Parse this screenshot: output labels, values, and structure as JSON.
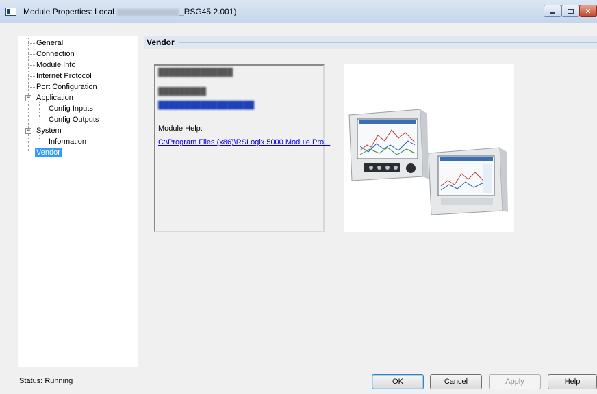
{
  "window": {
    "title_prefix": "Module Properties: Local ",
    "title_suffix": "_RSG45 2.001)",
    "controls": [
      "minimize-icon",
      "maximize-icon",
      "close-icon"
    ],
    "close_glyph": "✕"
  },
  "tree": {
    "items": [
      {
        "label": "General"
      },
      {
        "label": "Connection"
      },
      {
        "label": "Module Info"
      },
      {
        "label": "Internet Protocol"
      },
      {
        "label": "Port Configuration"
      },
      {
        "label": "Application",
        "expander": "−"
      },
      {
        "label": "Config Inputs"
      },
      {
        "label": "Config Outputs"
      },
      {
        "label": "System",
        "expander": "−"
      },
      {
        "label": "Information"
      },
      {
        "label": "Vendor",
        "selected": true
      }
    ]
  },
  "section": {
    "title": "Vendor"
  },
  "vendor": {
    "module_help_label": "Module Help:",
    "module_help_link": "C:\\Program Files (x86)\\RSLogix 5000 Module Pro..."
  },
  "status": {
    "label": "Status:",
    "value": "Running"
  },
  "buttons": {
    "ok": "OK",
    "cancel": "Cancel",
    "apply": "Apply",
    "help": "Help"
  },
  "colors": {
    "selection": "#3399ff",
    "link": "#0000ee",
    "window_bg": "#f0f0f0",
    "close_button": "#c6452a"
  }
}
